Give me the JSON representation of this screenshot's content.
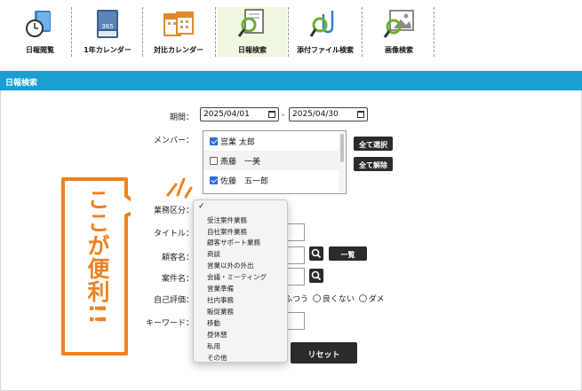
{
  "toolbar": {
    "items": [
      {
        "label": "日報閲覧",
        "icon": "clock-folder-icon"
      },
      {
        "label": "1年カレンダー",
        "icon": "book-calendar-icon"
      },
      {
        "label": "対比カレンダー",
        "icon": "double-calendar-icon"
      },
      {
        "label": "日報検索",
        "icon": "document-search-icon"
      },
      {
        "label": "添付ファイル検索",
        "icon": "attachment-search-icon"
      },
      {
        "label": "画像検索",
        "icon": "image-search-icon"
      }
    ],
    "calendar_badge": "365",
    "active_index": 3
  },
  "section": {
    "title": "日報検索",
    "header_color": "#1b9fd2"
  },
  "form": {
    "period_label": "期間：",
    "date_from": "2025/04/01",
    "date_separator": "-",
    "date_to": "2025/04/30",
    "member_label": "メンバー：",
    "members": [
      {
        "name": "営業 太郎",
        "checked": true
      },
      {
        "name": "斎藤　一美",
        "checked": false
      },
      {
        "name": "佐藤　五一郎",
        "checked": true
      }
    ],
    "select_all_label": "全て選択",
    "deselect_all_label": "全て解除",
    "business_label": "業務区分：",
    "title_label": "タイトル：",
    "customer_label": "顧客名：",
    "list_button_label": "一覧",
    "case_label": "案件名：",
    "evaluation_label": "自己評価：",
    "evaluation_options": [
      "ふつう",
      "良くない",
      "ダメ"
    ],
    "keyword_label": "キーワード：",
    "reset_label": "リセット"
  },
  "dropdown": {
    "selected_mark": "✓",
    "options": [
      "受注案件業務",
      "自社案件業務",
      "顧客サポート業務",
      "商談",
      "営業以外の外出",
      "会議・ミーティング",
      "営業準備",
      "社内事務",
      "販促業務",
      "移動",
      "昼休憩",
      "私用",
      "その他"
    ]
  },
  "callout": {
    "text": "ここが便利!!",
    "color": "#f0821e"
  }
}
